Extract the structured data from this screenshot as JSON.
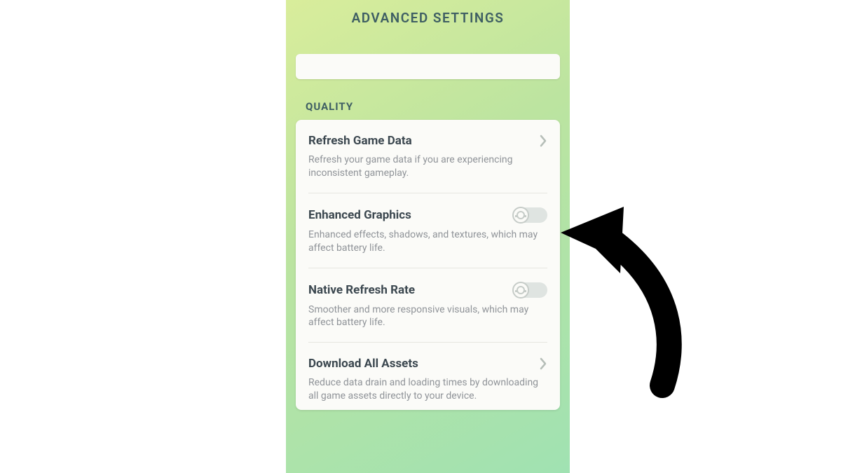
{
  "header": {
    "title": "ADVANCED SETTINGS"
  },
  "section": {
    "label": "QUALITY"
  },
  "settings": {
    "refresh": {
      "title": "Refresh Game Data",
      "desc": "Refresh your game data if you are experiencing inconsistent gameplay."
    },
    "graphics": {
      "title": "Enhanced Graphics",
      "desc": "Enhanced effects, shadows, and textures, which may affect battery life."
    },
    "refreshrate": {
      "title": "Native Refresh Rate",
      "desc": "Smoother and more responsive visuals, which may affect battery life."
    },
    "assets": {
      "title": "Download All Assets",
      "desc": "Reduce data drain and loading times by downloading all game assets directly to your device."
    }
  }
}
